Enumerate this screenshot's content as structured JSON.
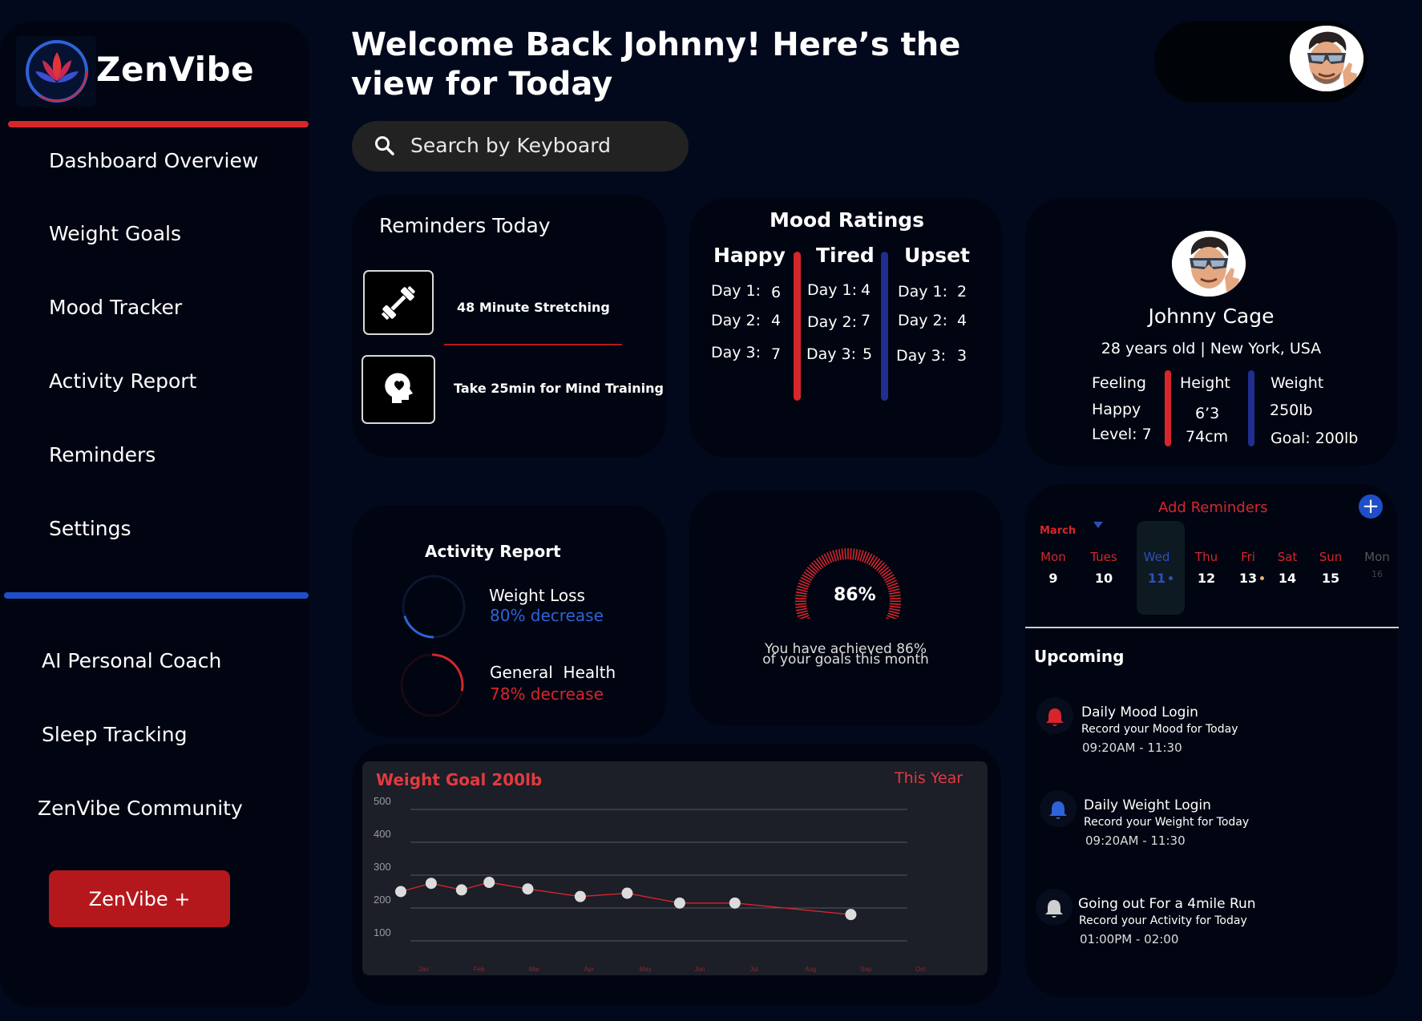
{
  "brand": {
    "name": "ZenVibe",
    "accent": "#d6262c",
    "blue": "#1f4fc8"
  },
  "sidebar": {
    "primary": [
      "Dashboard Overview",
      "Weight Goals",
      "Mood Tracker",
      "Activity Report",
      "Reminders",
      "Settings"
    ],
    "secondary": [
      "AI Personal Coach",
      "Sleep Tracking",
      "ZenVibe Community"
    ],
    "cta": "ZenVibe +"
  },
  "header": {
    "title": "Welcome Back Johnny! Here’s the view for Today",
    "search_placeholder": "Search by Keyboard"
  },
  "reminders_today": {
    "title": "Reminders Today",
    "items": [
      {
        "label": "48 Minute Stretching",
        "icon": "dumbbell-icon"
      },
      {
        "label": "Take 25min for Mind Training",
        "icon": "head-brain-icon"
      }
    ]
  },
  "mood": {
    "title": "Mood Ratings",
    "columns": [
      {
        "name": "Happy",
        "rows": [
          {
            "day": "Day 1:",
            "val": "6"
          },
          {
            "day": "Day 2:",
            "val": "4"
          },
          {
            "day": "Day 3:",
            "val": "7"
          }
        ]
      },
      {
        "name": "Tired",
        "rows": [
          {
            "day": "Day 1:",
            "val": "4"
          },
          {
            "day": "Day 2:",
            "val": "7"
          },
          {
            "day": "Day 3:",
            "val": "5"
          }
        ]
      },
      {
        "name": "Upset",
        "rows": [
          {
            "day": "Day 1:",
            "val": "2"
          },
          {
            "day": "Day 2:",
            "val": "4"
          },
          {
            "day": "Day 3:",
            "val": "3"
          }
        ]
      }
    ]
  },
  "profile": {
    "name": "Johnny Cage",
    "meta": "28 years old | New York, USA",
    "feeling_label": "Feeling",
    "feeling_value": "Happy",
    "level": "Level: 7",
    "height_label": "Height",
    "height_ft": "6’3",
    "height_cm": "74cm",
    "weight_label": "Weight",
    "weight_value": "250lb",
    "weight_goal": "Goal: 200lb"
  },
  "activity": {
    "title": "Activity Report",
    "items": [
      {
        "name": "Weight Loss",
        "status": "80% decrease",
        "color": "#2e63d8",
        "fraction": 0.2
      },
      {
        "name": "General  Health",
        "status": "78% decrease",
        "color": "#d6262c",
        "fraction": 0.28
      }
    ]
  },
  "goal": {
    "percent": "86%",
    "value": 0.86,
    "caption1": "You have achieved 86%",
    "caption2": "of your goals this month"
  },
  "calendar": {
    "add_label": "Add Reminders",
    "month": "March",
    "days": [
      {
        "d": "Mon",
        "n": "9"
      },
      {
        "d": "Tues",
        "n": "10"
      },
      {
        "d": "Wed",
        "n": "11"
      },
      {
        "d": "Thu",
        "n": "12"
      },
      {
        "d": "Fri",
        "n": "13"
      },
      {
        "d": "Sat",
        "n": "14"
      },
      {
        "d": "Sun",
        "n": "15"
      },
      {
        "d": "Mon",
        "n": "16"
      }
    ]
  },
  "upcoming": {
    "title": "Upcoming",
    "items": [
      {
        "title": "Daily Mood Login",
        "sub": "Record your Mood for Today",
        "time": "09:20AM - 11:30",
        "color": "#d6262c"
      },
      {
        "title": "Daily Weight Login",
        "sub": "Record your Weight for Today",
        "time": "09:20AM - 11:30",
        "color": "#2e63d8"
      },
      {
        "title": "Going out For a 4mile Run",
        "sub": "Record your Activity for Today",
        "time": "01:00PM - 02:00",
        "color": "#cfcfcf"
      }
    ]
  },
  "chart_data": {
    "type": "line",
    "title": "Weight Goal 200lb",
    "period": "This Year",
    "yticks": [
      500,
      400,
      300,
      200,
      100
    ],
    "ylim": [
      0,
      550
    ],
    "categories": [
      "Jan",
      "Feb",
      "Mar",
      "Apr",
      "May",
      "Jun",
      "Jul",
      "Aug",
      "Sep",
      "Oct"
    ],
    "x": [
      0,
      0.55,
      1.1,
      1.6,
      2.3,
      3.25,
      4.1,
      5.05,
      6.05,
      8.15
    ],
    "y": [
      250,
      275,
      255,
      278,
      258,
      235,
      245,
      215,
      215,
      180
    ],
    "line_color": "#d6262c",
    "grid": true
  }
}
